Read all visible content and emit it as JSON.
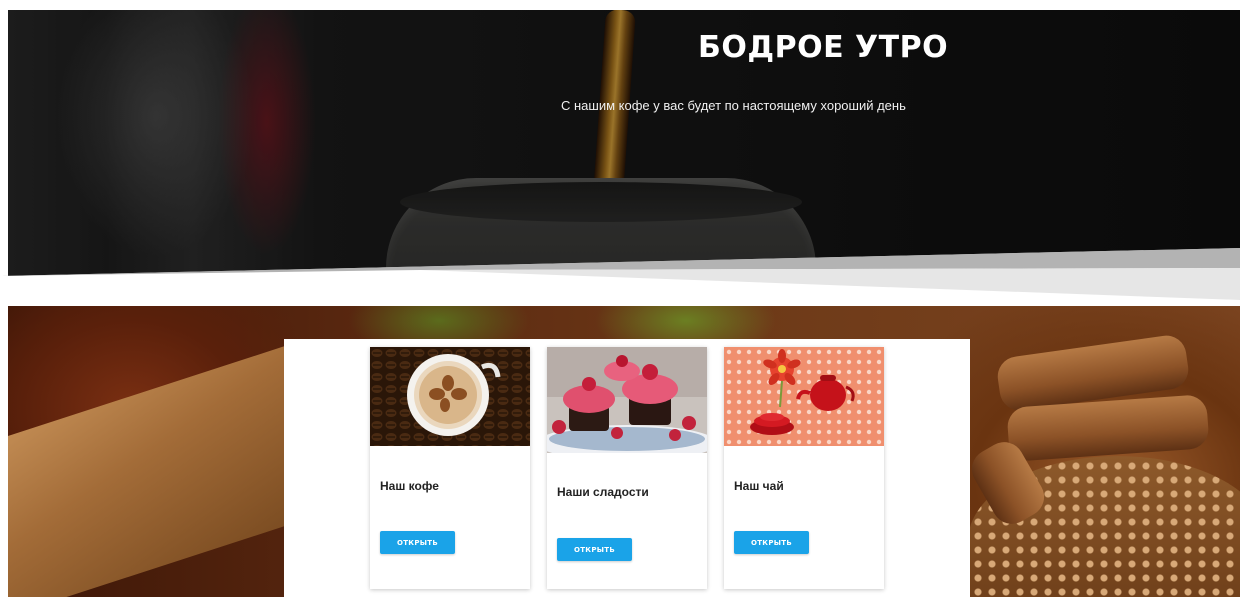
{
  "hero": {
    "title": "БОДРОЕ УТРО",
    "subtitle": "С нашим кофе у вас будет по настоящему хороший день"
  },
  "cards": [
    {
      "title": "Наш кофе",
      "button_label": "ОТКРЫТЬ",
      "image_icon": "coffee-cup-image"
    },
    {
      "title": "Наши сладости",
      "button_label": "ОТКРЫТЬ",
      "image_icon": "cupcakes-image"
    },
    {
      "title": "Наш чай",
      "button_label": "ОТКРЫТЬ",
      "image_icon": "tea-set-image"
    }
  ],
  "colors": {
    "button": "#1aa3e8",
    "hero_text": "#ffffff"
  }
}
